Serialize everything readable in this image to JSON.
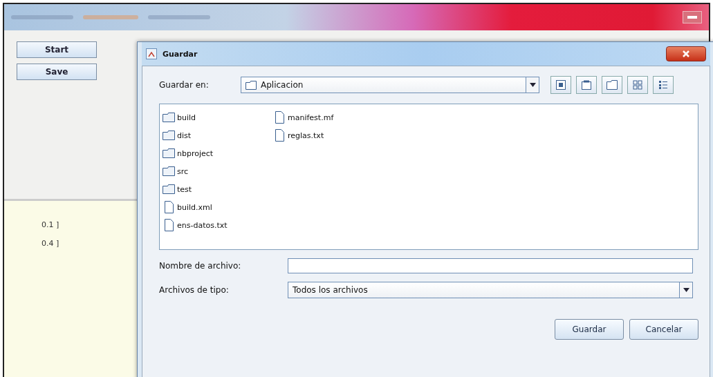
{
  "main_window": {
    "buttons": [
      "Start",
      "Save"
    ],
    "values": [
      "0.1 ]",
      "0.4 ]"
    ]
  },
  "dialog": {
    "title": "Guardar",
    "save_in": {
      "label": "Guardar en:",
      "value": "Aplicacion"
    },
    "files": [
      {
        "name": "build",
        "kind": "folder"
      },
      {
        "name": "dist",
        "kind": "folder"
      },
      {
        "name": "nbproject",
        "kind": "folder"
      },
      {
        "name": "src",
        "kind": "folder"
      },
      {
        "name": "test",
        "kind": "folder"
      },
      {
        "name": "build.xml",
        "kind": "file"
      },
      {
        "name": "ens-datos.txt",
        "kind": "file"
      },
      {
        "name": "manifest.mf",
        "kind": "file"
      },
      {
        "name": "reglas.txt",
        "kind": "file"
      }
    ],
    "file_name": {
      "label": "Nombre de archivo:"
    },
    "file_type": {
      "label": "Archivos de tipo:",
      "value": "Todos los archivos"
    },
    "buttons": [
      "Guardar",
      "Cancelar"
    ]
  }
}
